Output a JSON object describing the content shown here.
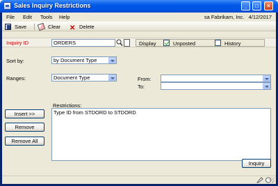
{
  "window": {
    "title": "Sales Inquiry Restrictions"
  },
  "menu": {
    "items": [
      "File",
      "Edit",
      "Tools",
      "Help"
    ],
    "company": "sa  Fabrikam, Inc.",
    "date": "4/12/2017"
  },
  "toolbar": {
    "save": "Save",
    "clear": "Clear",
    "delete": "Delete"
  },
  "inquiry": {
    "label": "Inquiry ID",
    "value": "ORDERS"
  },
  "display": {
    "label": "Display",
    "unposted": "Unposted",
    "unposted_checked": true,
    "history": "History",
    "history_checked": false
  },
  "sort": {
    "label": "Sort by:",
    "value": "by Document Type"
  },
  "ranges": {
    "label": "Ranges:",
    "value": "Document Type",
    "from_label": "From:",
    "to_label": "To:",
    "from_value": "",
    "to_value": ""
  },
  "restrictions": {
    "label": "Restrictions:",
    "text": "Type ID from STDORD to STDORD"
  },
  "buttons": {
    "insert": "Insert >>",
    "remove": "Remove",
    "remove_all": "Remove All",
    "inquiry": "Inquiry"
  },
  "colors": {
    "title_bar": "#0054e3",
    "required_label": "#c00000",
    "client_bg": "#ece9d8"
  }
}
